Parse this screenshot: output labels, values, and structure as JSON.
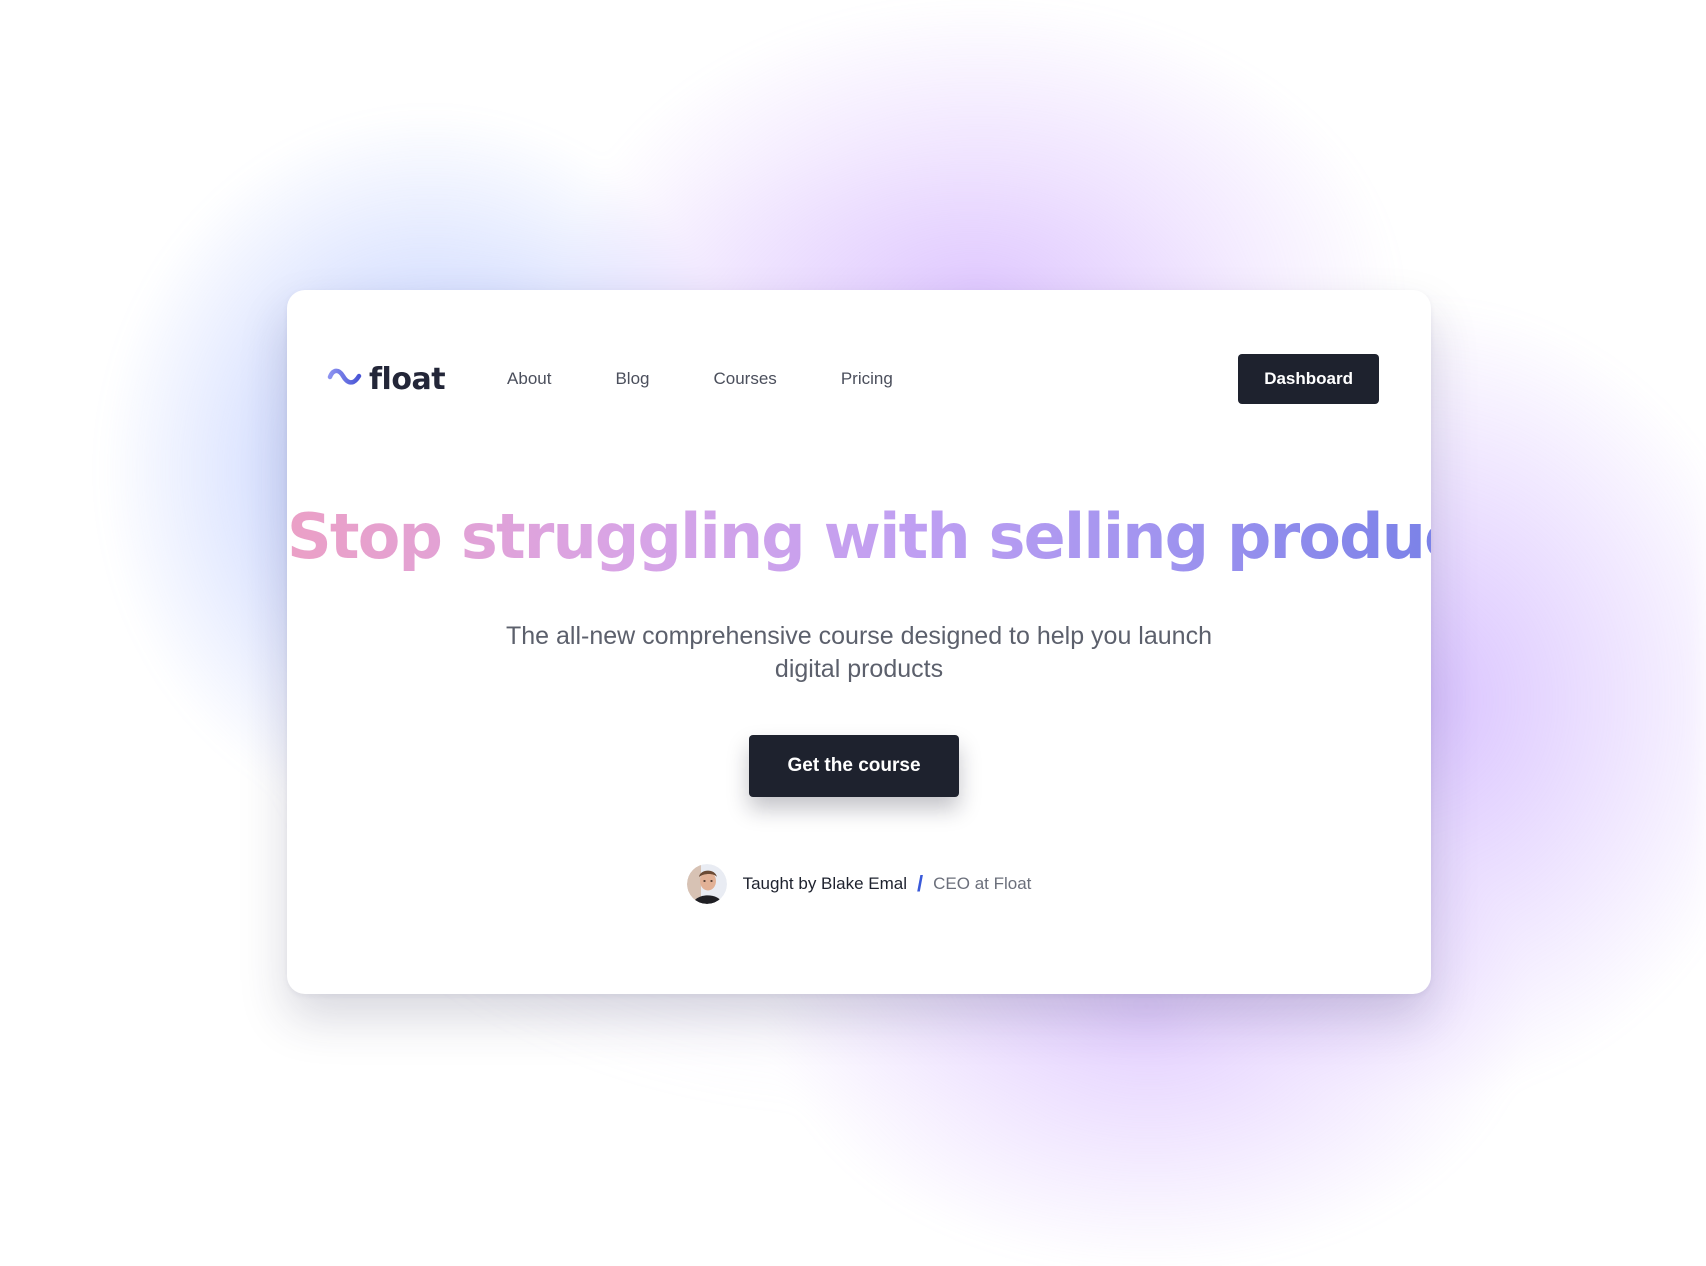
{
  "brand": {
    "name": "float",
    "icon": "wave-logo-icon",
    "colors": {
      "logo_gradient": [
        "#7d86ee",
        "#4f5bdb"
      ],
      "text_dark": "#232638"
    }
  },
  "nav": {
    "links": [
      {
        "label": "About"
      },
      {
        "label": "Blog"
      },
      {
        "label": "Courses"
      },
      {
        "label": "Pricing"
      }
    ],
    "dashboard_label": "Dashboard"
  },
  "hero": {
    "headline": "Stop struggling with selling products.",
    "headline_gradient": [
      "#eba0c6",
      "#d8a4e6",
      "#bf9ff2",
      "#9e93ef",
      "#7b82e8"
    ],
    "subtitle": "The all-new comprehensive course designed to help you launch digital products",
    "cta_label": "Get the course"
  },
  "author": {
    "avatar_icon": "author-avatar",
    "taught_by": "Taught by Blake Emal",
    "separator": "/",
    "role": "CEO at Float"
  },
  "theme": {
    "button_bg": "#1e222e",
    "accent_blue": "#3a5ad9",
    "glow_blue": "#7896ff",
    "glow_purple": "#be8cff"
  }
}
